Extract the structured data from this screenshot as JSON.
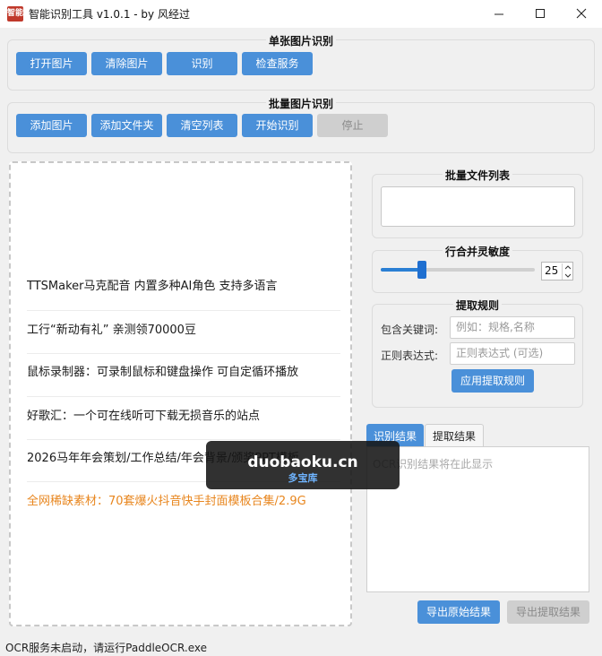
{
  "window": {
    "icon_text": "智能",
    "title": "智能识别工具 v1.0.1 - by 风经过",
    "controls": {
      "minimize": "minimize-icon",
      "maximize": "maximize-icon",
      "close": "close-icon"
    }
  },
  "single_group": {
    "title": "单张图片识别",
    "buttons": [
      "打开图片",
      "清除图片",
      "识别",
      "检查服务"
    ]
  },
  "batch_group": {
    "title": "批量图片识别",
    "buttons": [
      "添加图片",
      "添加文件夹",
      "清空列表",
      "开始识别",
      "停止"
    ],
    "disabled": [
      "停止"
    ]
  },
  "image_area": {
    "items": [
      "TTSMaker马克配音 内置多种AI角色 支持多语言",
      "工行“新动有礼” 亲测领70000豆",
      "鼠标录制器：可录制鼠标和键盘操作 可自定循环播放",
      "好歌汇：一个可在线听可下载无损音乐的站点",
      "2026马年年会策划/工作总结/年会背景/颁奖PPT模板",
      "全网稀缺素材：70套爆火抖音快手封面模板合集/2.9G"
    ],
    "highlight_color": "#e8861e"
  },
  "file_list_group": {
    "title": "批量文件列表"
  },
  "sensitivity_group": {
    "title": "行合并灵敏度",
    "value": "25",
    "fraction": 0.27
  },
  "extract_group": {
    "title": "提取规则",
    "keyword_label": "包含关键词:",
    "keyword_placeholder": "例如：规格,名称",
    "regex_label": "正则表达式:",
    "regex_placeholder": "正则表达式 (可选)",
    "apply_button": "应用提取规则"
  },
  "results": {
    "tabs": [
      "识别结果",
      "提取结果"
    ],
    "active_tab": "识别结果",
    "placeholder": "OCR识别结果将在此显示",
    "export_raw": "导出原始结果",
    "export_extract": "导出提取结果"
  },
  "status": {
    "text": "OCR服务未启动，请运行PaddleOCR.exe"
  },
  "watermark": {
    "main": "duobaoku.cn",
    "sub": "多宝库"
  },
  "colors": {
    "accent": "#4a90d9",
    "slider": "#2a7fd4",
    "disabled": "#cfcfcf"
  }
}
